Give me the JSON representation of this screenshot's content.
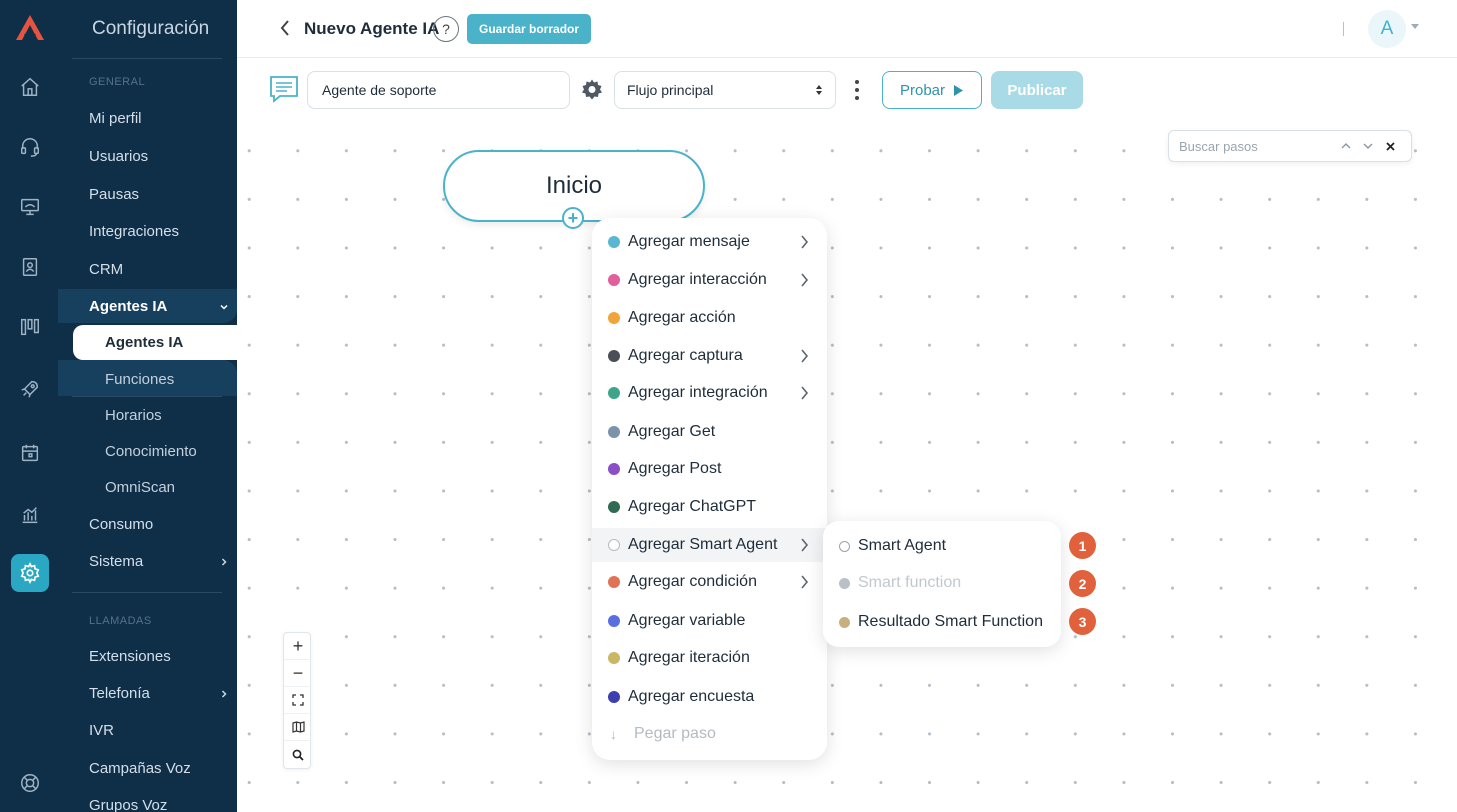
{
  "sidebar": {
    "title": "Configuración",
    "sections": {
      "general": "GENERAL",
      "calls": "LLAMADAS"
    },
    "items": {
      "profile": "Mi perfil",
      "users": "Usuarios",
      "pauses": "Pausas",
      "integrations": "Integraciones",
      "crm": "CRM",
      "ai_agents_group": "Agentes IA",
      "ai_agents": "Agentes IA",
      "functions": "Funciones",
      "schedules": "Horarios",
      "knowledge": "Conocimiento",
      "omniscan": "OmniScan",
      "consumption": "Consumo",
      "system": "Sistema",
      "extensions": "Extensiones",
      "telephony": "Telefonía",
      "ivr": "IVR",
      "voice_campaigns": "Campañas Voz",
      "voice_groups": "Grupos Voz"
    }
  },
  "header": {
    "title": "Nuevo Agente IA",
    "help": "?",
    "save_draft": "Guardar borrador",
    "avatar_initial": "A"
  },
  "toolbar": {
    "agent_name": "Agente de soporte",
    "flow": "Flujo principal",
    "test": "Probar",
    "publish": "Publicar"
  },
  "search": {
    "placeholder": "Buscar pasos"
  },
  "start_node": {
    "label": "Inicio"
  },
  "menu": {
    "items": [
      {
        "label": "Agregar mensaje",
        "color": "#5ab6d3"
      },
      {
        "label": "Agregar interacción",
        "color": "#e0609e"
      },
      {
        "label": "Agregar acción",
        "color": "#f0a53a"
      },
      {
        "label": "Agregar captura",
        "color": "#4a4f55"
      },
      {
        "label": "Agregar integración",
        "color": "#3fa58a"
      },
      {
        "label": "Agregar Get",
        "color": "#7a93ab"
      },
      {
        "label": "Agregar Post",
        "color": "#8a4fc8"
      },
      {
        "label": "Agregar ChatGPT",
        "color": "#2f6a55"
      },
      {
        "label": "Agregar Smart Agent",
        "color": "#ffffff"
      },
      {
        "label": "Agregar condición",
        "color": "#e07255"
      },
      {
        "label": "Agregar variable",
        "color": "#5a6ee0"
      },
      {
        "label": "Agregar iteración",
        "color": "#c9b765"
      },
      {
        "label": "Agregar encuesta",
        "color": "#3d3fb0"
      }
    ],
    "paste": "Pegar paso"
  },
  "submenu": {
    "items": [
      {
        "label": "Smart Agent",
        "badge": "1",
        "color": "#ffffff"
      },
      {
        "label": "Smart function",
        "badge": "2",
        "color": "#b9c0c7"
      },
      {
        "label": "Resultado Smart Function",
        "badge": "3",
        "color": "#c8b07e"
      }
    ]
  },
  "colors": {
    "accent": "#4ab2c9",
    "sidebar_bg": "#0f2f49",
    "badge": "#e0613c"
  },
  "zoom_controls": {
    "zoom_in": "+",
    "zoom_out": "−"
  }
}
